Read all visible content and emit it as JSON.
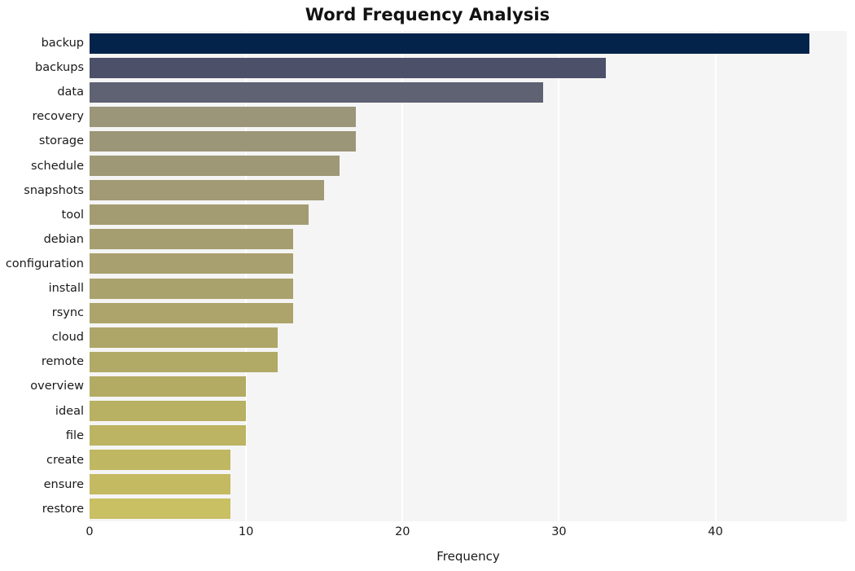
{
  "chart_data": {
    "type": "bar",
    "orientation": "horizontal",
    "title": "Word Frequency Analysis",
    "xlabel": "Frequency",
    "ylabel": "",
    "xlim": [
      0,
      48.4
    ],
    "ylim": [
      0,
      20
    ],
    "grid": true,
    "legend": null,
    "xticks": [
      0,
      10,
      20,
      30,
      40
    ],
    "xtick_labels": [
      "0",
      "10",
      "20",
      "30",
      "40"
    ],
    "categories": [
      "backup",
      "backups",
      "data",
      "recovery",
      "storage",
      "schedule",
      "snapshots",
      "tool",
      "debian",
      "configuration",
      "install",
      "rsync",
      "cloud",
      "remote",
      "overview",
      "ideal",
      "file",
      "create",
      "ensure",
      "restore"
    ],
    "values": [
      46,
      33,
      29,
      17,
      17,
      16,
      15,
      14,
      13,
      13,
      13,
      13,
      12,
      12,
      10,
      10,
      10,
      9,
      9,
      9
    ],
    "bar_colors": [
      "#03234b",
      "#4c5069",
      "#5e6272",
      "#9b957a",
      "#9c9679",
      "#9e9876",
      "#a19a74",
      "#a39c72",
      "#a59e70",
      "#a8a06e",
      "#aaa26c",
      "#aca46a",
      "#aea668",
      "#b1a966",
      "#b3ab64",
      "#b8b062",
      "#bcb462",
      "#c0b762",
      "#c4ba62",
      "#c9bf63"
    ],
    "plot_background": "#f5f5f5",
    "grid_color": "#ffffff",
    "figure_background": "#ffffff"
  }
}
